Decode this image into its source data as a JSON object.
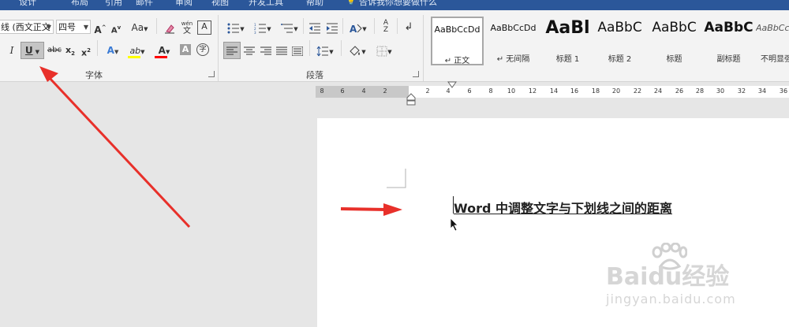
{
  "ribbon_tabs": [
    "设计",
    "布局",
    "引用",
    "邮件",
    "审阅",
    "视图",
    "开发工具",
    "帮助",
    "告诉我你想要做什么"
  ],
  "font": {
    "name_value": "线 (西文正文",
    "size_value": "四号",
    "group_label": "字体"
  },
  "paragraph": {
    "group_label": "段落"
  },
  "styles": [
    {
      "preview": "AaBbCcDd",
      "name": "正文"
    },
    {
      "preview": "AaBbCcDd",
      "name": "无间隔"
    },
    {
      "preview": "AaBl",
      "name": "标题 1"
    },
    {
      "preview": "AaBbC",
      "name": "标题 2"
    },
    {
      "preview": "AaBbC",
      "name": "标题"
    },
    {
      "preview": "AaBbC",
      "name": "副标题"
    },
    {
      "preview": "AaBbCc",
      "name": "不明显强调"
    }
  ],
  "ruler_ticks": [
    "8",
    "6",
    "4",
    "2",
    "2",
    "4",
    "6",
    "8",
    "10",
    "12",
    "14",
    "16",
    "18",
    "20",
    "22",
    "24",
    "26",
    "28",
    "30",
    "32",
    "34",
    "36"
  ],
  "document": {
    "text": "Word 中调整文字与下划线之间的距离"
  },
  "watermark": {
    "brand": "Baidu经验",
    "url": "jingyan.baidu.com"
  },
  "colors": {
    "title_bar": "#2b579a",
    "arrow": "#e8302a",
    "highlight": "#ffff00",
    "font_color": "#ff0000"
  }
}
